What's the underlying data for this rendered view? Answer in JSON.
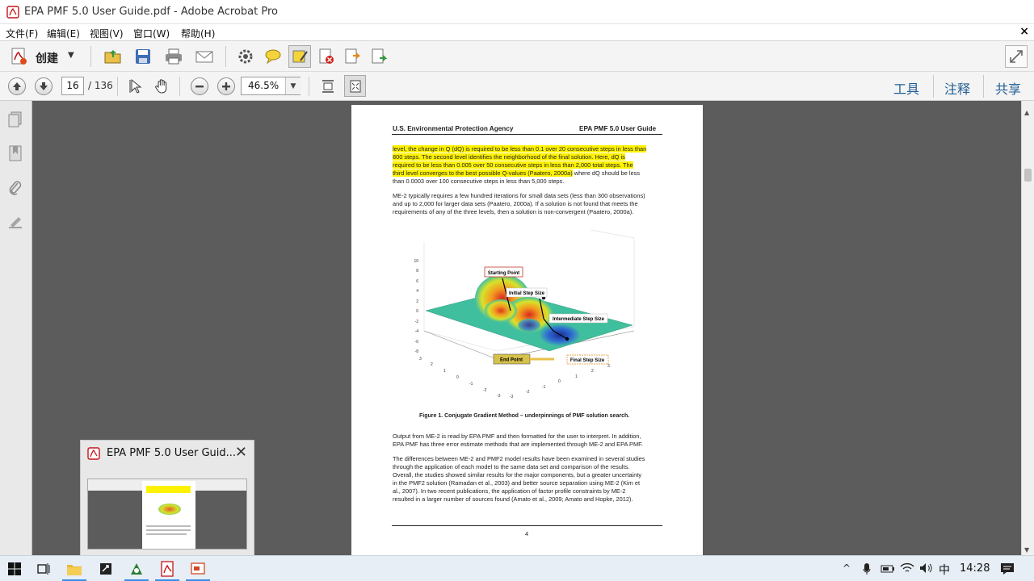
{
  "window": {
    "title": "EPA PMF 5.0 User Guide.pdf - Adobe Acrobat Pro",
    "close_doc_glyph": "×"
  },
  "menus": [
    "文件(F)",
    "编辑(E)",
    "视图(V)",
    "窗口(W)",
    "帮助(H)"
  ],
  "toolbar1": {
    "create_label": "创建"
  },
  "toolbar2": {
    "current_page": "16",
    "total_pages": "/ 136",
    "zoom": "46.5%",
    "right_tabs": [
      "工具",
      "注释",
      "共享"
    ]
  },
  "document": {
    "header_left": "U.S. Environmental Protection Agency",
    "header_right": "EPA PMF 5.0 User Guide",
    "para1": [
      "level, the change in Q (dQ) is required to be less than 0.1 over 20 consecutive steps in less than",
      "800 steps.  The second level identifies the neighborhood of the final solution.  Here, dQ is",
      "required to be less than 0.005 over 50 consecutive steps in less than 2,000 total steps.  The",
      "third level converges to the best possible Q-values (Paatero, 2000a)",
      " where dQ should be less",
      "than 0.0003 over 100 consecutive steps in less than 5,000 steps."
    ],
    "para2": [
      "ME-2 typically requires a few hundred iterations for small data sets (less than 300 observations)",
      "and up to 2,000 for larger data sets (Paatero, 2000a).  If a solution is not found that meets the",
      "requirements of any of the three levels, then a solution is non-convergent (Paatero, 2000a)."
    ],
    "figure": {
      "labels": {
        "start": "Starting Point",
        "initial": "Initial Step Size",
        "intermediate": "Intermediate Step Size",
        "end": "End Point",
        "final": "Final Step Size"
      },
      "z_ticks": [
        "10",
        "8",
        "6",
        "4",
        "2",
        "0",
        "-2",
        "-4",
        "-6",
        "-8"
      ],
      "x_ticks": [
        "3",
        "2",
        "1",
        "0",
        "-1",
        "-2",
        "-3"
      ],
      "y_ticks": [
        "-3",
        "-2",
        "-1",
        "0",
        "1",
        "2",
        "3"
      ],
      "caption": "Figure 1.  Conjugate Gradient Method – underpinnings of PMF solution search."
    },
    "para3": [
      "Output from ME-2 is read by EPA PMF and then formatted for the user to interpret.  In addition,",
      "EPA PMF has three error estimate methods that are implemented through ME-2 and EPA PMF."
    ],
    "para4": [
      "The differences between ME-2 and PMF2 model results have been examined in several studies",
      "through the application of each model to the same data set and comparison of the results.",
      "Overall, the studies showed similar results for the major components, but a greater uncertainty",
      "in the PMF2 solution (Ramadan et al., 2003) and better source separation using ME-2 (Kim et",
      "al., 2007).  In two recent publications, the application of factor profile constraints by ME-2",
      "resulted in a larger number of sources found (Amato et al., 2009; Amato and Hopke, 2012)."
    ],
    "page_number": "4"
  },
  "thumbnail": {
    "title": "EPA PMF 5.0 User Guid..."
  },
  "taskbar": {
    "ime": "中",
    "time": "14:28"
  },
  "colors": {
    "highlight": "#fff200",
    "tab_blue": "#1f5e93",
    "doc_bg": "#5c5c5c",
    "acrobat_red": "#c4161c"
  }
}
